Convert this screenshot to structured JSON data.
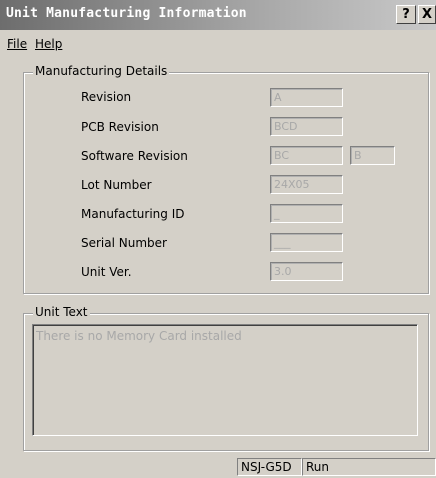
{
  "window": {
    "title": "Unit Manufacturing Information"
  },
  "title_buttons": {
    "help": "?",
    "close": "X"
  },
  "menu": {
    "file": "File",
    "help": "Help"
  },
  "manufacturing": {
    "legend": "Manufacturing Details",
    "rows": [
      {
        "label": "Revision",
        "value": "A"
      },
      {
        "label": "PCB Revision",
        "value": "BCD"
      },
      {
        "label": "Software Revision",
        "value": "BC",
        "value2": "B"
      },
      {
        "label": "Lot Number",
        "value": "24X05"
      },
      {
        "label": "Manufacturing ID",
        "value": "_"
      },
      {
        "label": "Serial Number",
        "value": "___"
      },
      {
        "label": "Unit Ver.",
        "value": "3.0"
      }
    ]
  },
  "unit_text": {
    "legend": "Unit Text",
    "content": "There is no Memory Card installed"
  },
  "status": {
    "model": "NSJ-G5D",
    "mode": "Run"
  }
}
